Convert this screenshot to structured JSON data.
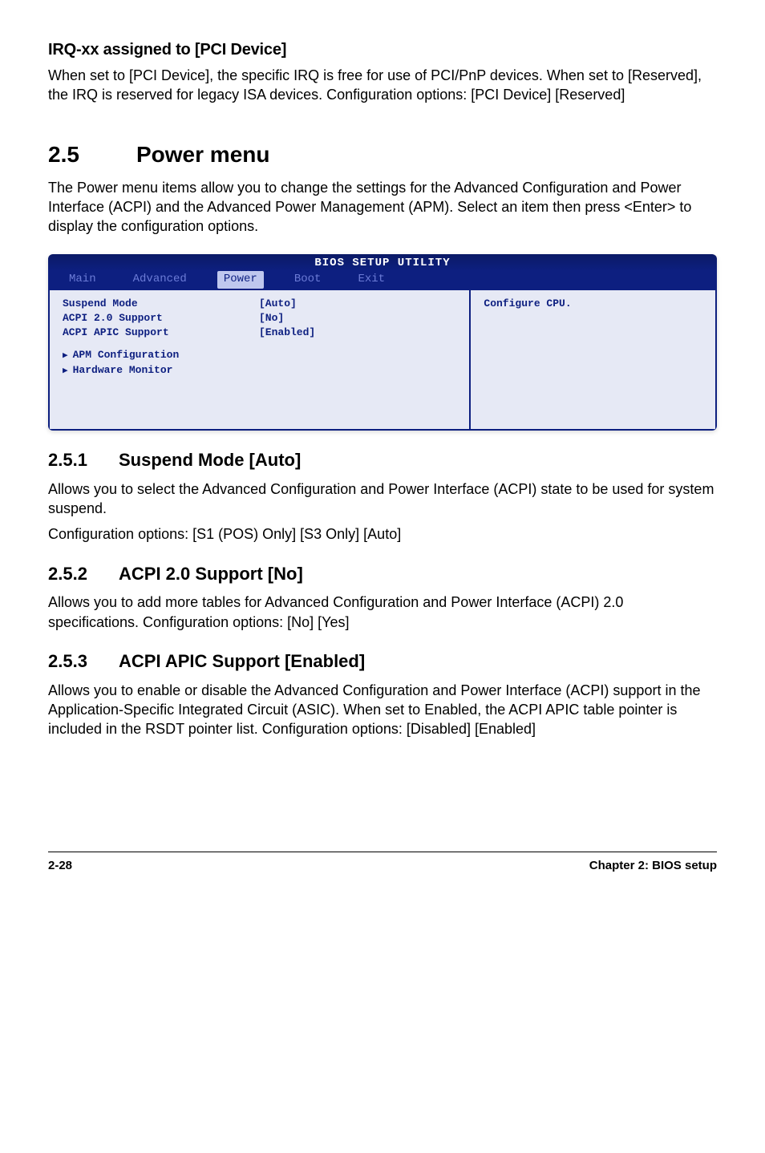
{
  "irq": {
    "heading": "IRQ-xx assigned to [PCI Device]",
    "body": "When set to [PCI Device], the specific IRQ is free for use of PCI/PnP devices. When set to [Reserved], the IRQ is reserved for legacy ISA devices. Configuration options: [PCI Device] [Reserved]"
  },
  "section25": {
    "num": "2.5",
    "title": "Power menu",
    "body": "The Power menu items allow you to change the settings for the Advanced Configuration and Power Interface (ACPI) and the Advanced Power Management (APM). Select an item then press <Enter> to display the configuration options."
  },
  "bios": {
    "title": "BIOS SETUP UTILITY",
    "tabs": [
      "Main",
      "Advanced",
      "Power",
      "Boot",
      "Exit"
    ],
    "active_tab_index": 2,
    "items": [
      {
        "label": "Suspend Mode",
        "value": "[Auto]"
      },
      {
        "label": "ACPI 2.0 Support",
        "value": "[No]"
      },
      {
        "label": "ACPI APIC Support",
        "value": "[Enabled]"
      }
    ],
    "subitems": [
      "APM Configuration",
      "Hardware Monitor"
    ],
    "help": "Configure CPU."
  },
  "s251": {
    "num": "2.5.1",
    "title": "Suspend Mode [Auto]",
    "p1": "Allows you to select the Advanced Configuration and Power Interface (ACPI) state to be used for system suspend.",
    "p2": "Configuration options: [S1 (POS) Only] [S3 Only] [Auto]"
  },
  "s252": {
    "num": "2.5.2",
    "title": "ACPI 2.0 Support [No]",
    "body": "Allows you to add more tables for Advanced Configuration and Power Interface (ACPI) 2.0 specifications. Configuration options: [No] [Yes]"
  },
  "s253": {
    "num": "2.5.3",
    "title": "ACPI APIC Support [Enabled]",
    "body": "Allows you to enable or disable the Advanced Configuration and Power Interface (ACPI) support in the Application-Specific Integrated Circuit (ASIC). When set to Enabled, the ACPI APIC table pointer is included in the RSDT pointer list. Configuration options: [Disabled] [Enabled]"
  },
  "footer": {
    "page": "2-28",
    "chapter": "Chapter 2: BIOS setup"
  }
}
